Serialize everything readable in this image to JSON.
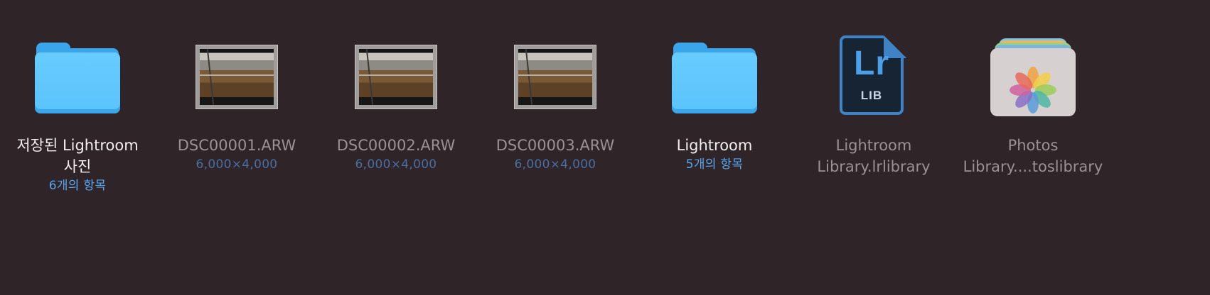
{
  "items": [
    {
      "name": "저장된 Lightroom\n사진",
      "sub": "6개의 항목"
    },
    {
      "name": "DSC00001.ARW",
      "sub": "6,000×4,000"
    },
    {
      "name": "DSC00002.ARW",
      "sub": "6,000×4,000"
    },
    {
      "name": "DSC00003.ARW",
      "sub": "6,000×4,000"
    },
    {
      "name": "Lightroom",
      "sub": "5개의 항목"
    },
    {
      "name": "Lightroom\nLibrary.lrlibrary",
      "sub": ""
    },
    {
      "name": "Photos\nLibrary....toslibrary",
      "sub": ""
    }
  ],
  "lrlib_icon": {
    "big": "Lr",
    "small": "LIB"
  },
  "colors": {
    "background": "#2f2427",
    "folder": "#5bc3fb",
    "sub_blue": "#58a6f0",
    "lr_accent": "#3f83c4"
  }
}
